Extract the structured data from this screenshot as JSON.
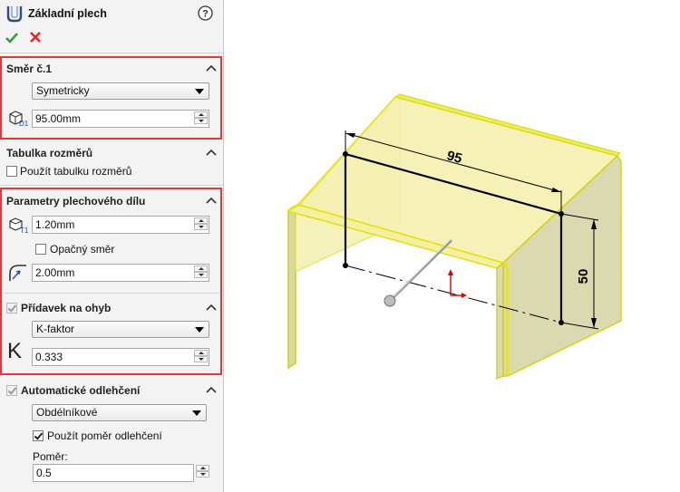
{
  "header": {
    "title": "Základní plech",
    "help_icon": "question-icon",
    "ok_icon": "check-icon",
    "cancel_icon": "x-icon"
  },
  "direction": {
    "title": "Směr č.1",
    "end_condition": "Symetricky",
    "depth_icon": "depth-d1-icon",
    "depth": "95.00mm"
  },
  "gauge_table": {
    "title": "Tabulka rozměrů",
    "use_label": "Použít tabulku rozměrů",
    "checked": false
  },
  "sheet_params": {
    "title": "Parametry plechového dílu",
    "thickness_icon": "thickness-t1-icon",
    "thickness": "1.20mm",
    "reverse_label": "Opačný směr",
    "reverse_checked": false,
    "radius_icon": "bend-radius-icon",
    "radius": "2.00mm"
  },
  "bend_allowance": {
    "title": "Přídavek na ohyb",
    "checked": true,
    "type": "K-faktor",
    "k_icon": "K",
    "k_value": "0.333"
  },
  "relief": {
    "title": "Automatické odlehčení",
    "checked": true,
    "type": "Obdélníkové",
    "use_ratio_label": "Použít poměr odlehčení",
    "use_ratio_checked": true,
    "ratio_label": "Poměr:",
    "ratio": "0.5"
  },
  "model": {
    "dim_width": "95",
    "dim_height": "50",
    "colors": {
      "face": "#f5f0a8",
      "edge": "#e6e600",
      "sketch": "#000000",
      "triad": "#e00000"
    }
  }
}
